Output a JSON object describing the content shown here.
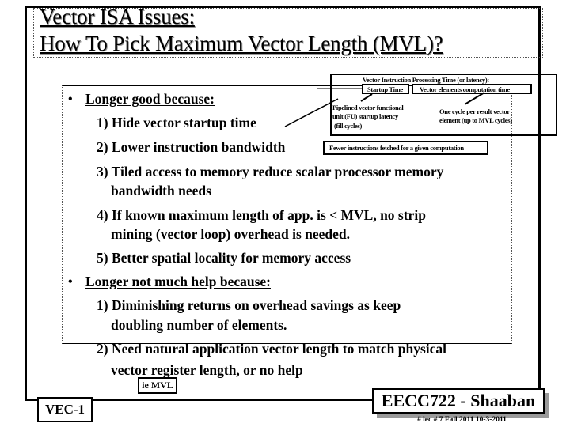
{
  "slide": {
    "title_line1": "Vector ISA Issues:",
    "title_line2": "How To Pick Maximum Vector Length (MVL)?",
    "section1": {
      "bullet": "•",
      "heading": "Longer good because:",
      "items": [
        "1) Hide vector startup time",
        "2) Lower instruction bandwidth",
        "3) Tiled access to memory reduce scalar processor memory",
        "bandwidth needs",
        "4) If known maximum  length of app. is < MVL, no strip",
        "mining (vector loop) overhead is needed.",
        "5) Better spatial locality for memory access"
      ]
    },
    "section2": {
      "bullet": "•",
      "heading": "Longer not much help because:",
      "items": [
        "1) Diminishing returns on overhead savings as keep",
        "doubling number of elements.",
        "2) Need natural application vector length to match physical",
        "vector register length, or no help"
      ]
    },
    "diagram": {
      "title": "Vector Instruction Processing Time (or latency):",
      "startup_label": "Startup Time",
      "elements_label": "Vector elements computation time",
      "startup_note_line1": "Pipelined vector functional",
      "startup_note_line2": "unit (FU) startup latency",
      "startup_note_line3": "(fill cycles)",
      "elements_note_line1": "One cycle per result vector",
      "elements_note_line2": "element (up to MVL cycles)",
      "fewer_label": "Fewer instructions fetched for a given computation"
    },
    "ie_mvl": "ie MVL",
    "footer": {
      "slide_id": "VEC-1",
      "course": "EECC722 - Shaaban",
      "meta": "#  lec # 7    Fall 2011    10-3-2011"
    }
  }
}
